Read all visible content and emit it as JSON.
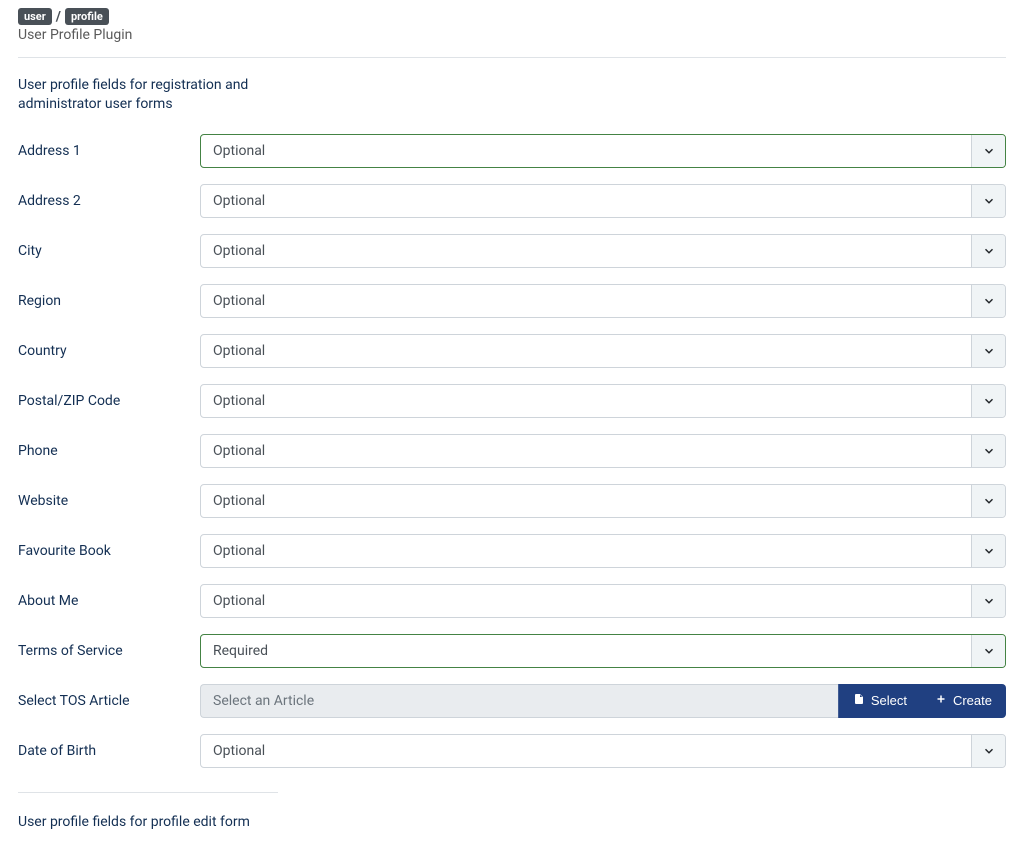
{
  "header": {
    "tag1": "user",
    "tag2": "profile",
    "plugin_title": "User Profile Plugin"
  },
  "section1_heading": "User profile fields for registration and administrator user forms",
  "section2_heading": "User profile fields for profile edit form",
  "fields": {
    "address1": {
      "label": "Address 1",
      "value": "Optional"
    },
    "address2": {
      "label": "Address 2",
      "value": "Optional"
    },
    "city": {
      "label": "City",
      "value": "Optional"
    },
    "region": {
      "label": "Region",
      "value": "Optional"
    },
    "country": {
      "label": "Country",
      "value": "Optional"
    },
    "postal": {
      "label": "Postal/ZIP Code",
      "value": "Optional"
    },
    "phone": {
      "label": "Phone",
      "value": "Optional"
    },
    "website": {
      "label": "Website",
      "value": "Optional"
    },
    "favbook": {
      "label": "Favourite Book",
      "value": "Optional"
    },
    "aboutme": {
      "label": "About Me",
      "value": "Optional"
    },
    "tos": {
      "label": "Terms of Service",
      "value": "Required"
    },
    "tos_article": {
      "label": "Select TOS Article",
      "placeholder": "Select an Article"
    },
    "dob": {
      "label": "Date of Birth",
      "value": "Optional"
    }
  },
  "buttons": {
    "select": "Select",
    "create": "Create"
  }
}
